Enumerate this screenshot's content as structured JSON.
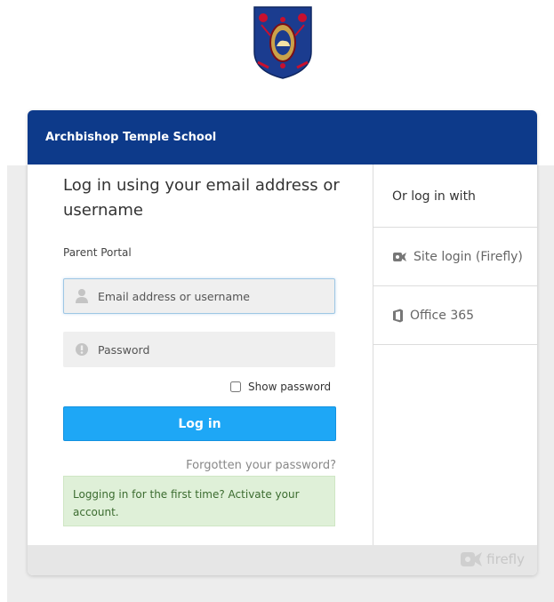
{
  "school": {
    "crest_icon": "school-crest-icon"
  },
  "card": {
    "title": "Archbishop Temple School",
    "header_color": "#0d3a8a"
  },
  "login": {
    "heading": "Log in using your email address or username",
    "portal_label": "Parent Portal",
    "email_placeholder": "Email address or username",
    "email_value": "",
    "password_placeholder": "Password",
    "password_value": "",
    "show_password_label": "Show password",
    "show_password_checked": false,
    "submit_label": "Log in",
    "submit_color": "#1ea7f6",
    "forgot_label": "Forgotten your password?",
    "first_time_notice": "Logging in for the first time? Activate your account."
  },
  "alt": {
    "title": "Or log in with",
    "items": [
      {
        "label": "Site login (Firefly)",
        "icon": "firefly-icon"
      },
      {
        "label": "Office 365",
        "icon": "office-365-icon"
      }
    ]
  },
  "footer": {
    "brand": "firefly"
  }
}
